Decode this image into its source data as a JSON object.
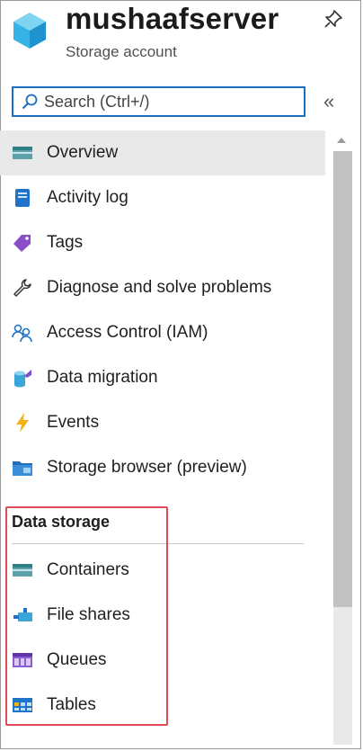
{
  "header": {
    "title": "mushaafserver",
    "subtitle": "Storage account"
  },
  "search": {
    "placeholder": "Search (Ctrl+/)"
  },
  "collapse_glyph": "«",
  "menu": {
    "items": [
      {
        "label": "Overview",
        "icon": "overview-icon",
        "active": true
      },
      {
        "label": "Activity log",
        "icon": "activity-log-icon"
      },
      {
        "label": "Tags",
        "icon": "tag-icon"
      },
      {
        "label": "Diagnose and solve problems",
        "icon": "wrench-icon"
      },
      {
        "label": "Access Control (IAM)",
        "icon": "people-icon"
      },
      {
        "label": "Data migration",
        "icon": "data-migration-icon"
      },
      {
        "label": "Events",
        "icon": "lightning-icon"
      },
      {
        "label": "Storage browser (preview)",
        "icon": "storage-browser-icon"
      }
    ]
  },
  "data_storage": {
    "title": "Data storage",
    "items": [
      {
        "label": "Containers",
        "icon": "containers-icon"
      },
      {
        "label": "File shares",
        "icon": "file-shares-icon"
      },
      {
        "label": "Queues",
        "icon": "queues-icon"
      },
      {
        "label": "Tables",
        "icon": "tables-icon"
      }
    ]
  },
  "colors": {
    "accent": "#1b6ec2",
    "highlight_border": "#e04c55",
    "active_row": "#e9e9e9"
  }
}
